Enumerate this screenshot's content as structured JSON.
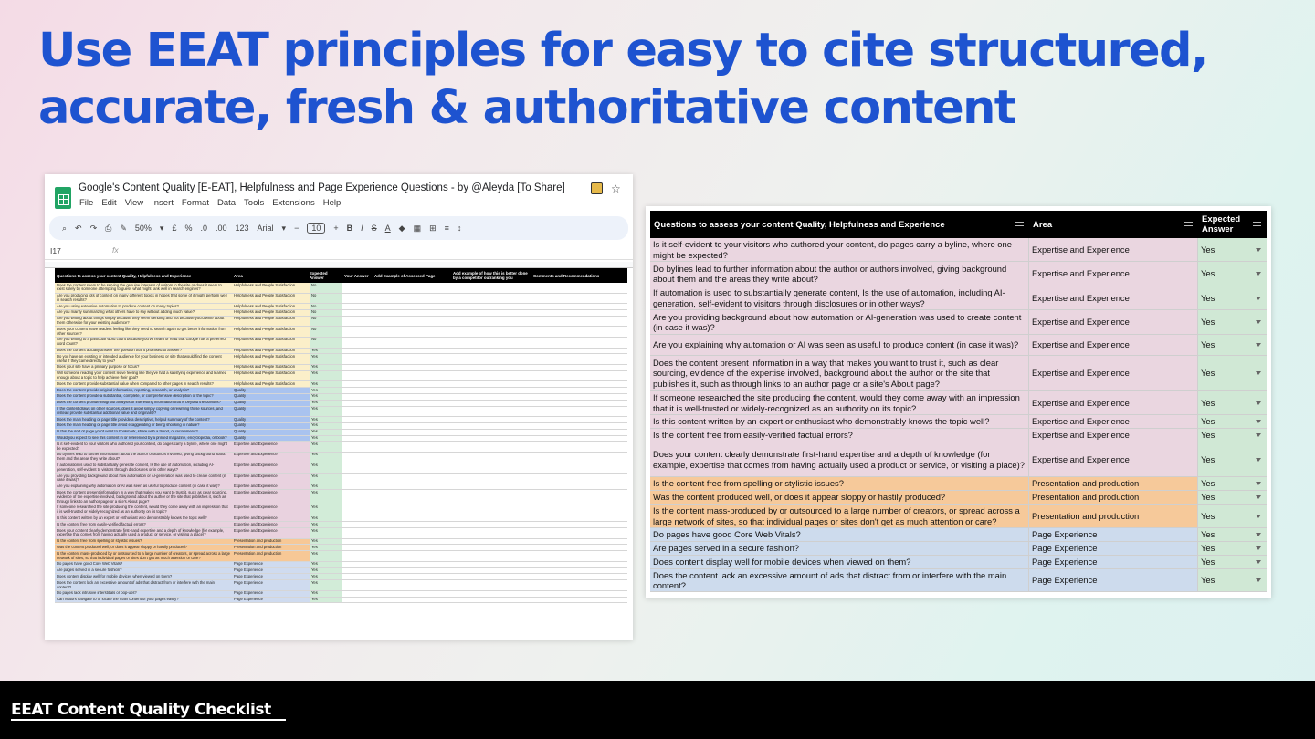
{
  "slide": {
    "title_line1": "Use EEAT principles for easy to cite structured,",
    "title_line2": "accurate, fresh & authoritative content",
    "footer_label": "EEAT Content Quality Checklist"
  },
  "sheet": {
    "title": "Google's Content Quality [E-EAT], Helpfulness and Page Experience Questions - by @Aleyda [To Share]",
    "menu": [
      "File",
      "Edit",
      "View",
      "Insert",
      "Format",
      "Data",
      "Tools",
      "Extensions",
      "Help"
    ],
    "zoom": "50%",
    "font": "Arial",
    "font_size": "10",
    "cell_ref": "I17",
    "fx": "fx",
    "headers": [
      "Questions to assess your content Quality, Helpfulness and Experience",
      "Area",
      "Expected Answer",
      "Your Answer",
      "Add Example of Assessed Page",
      "Add example of how this is better done by a competitor outranking you",
      "Comments and Recommendations"
    ],
    "rows": [
      {
        "q": "Does the content seem to be serving the genuine interests of visitors to the site or does it seem to exist solely by someone attempting to guess what might rank well in search engines?",
        "a": "Helpfulness and People Satisfaction",
        "e": "No",
        "bg": "bg-y"
      },
      {
        "q": "Are you producing lots of content on many different topics in hopes that some of it might perform well in search results?",
        "a": "Helpfulness and People Satisfaction",
        "e": "No",
        "bg": "bg-y"
      },
      {
        "q": "Are you using extensive automation to produce content on many topics?",
        "a": "Helpfulness and People Satisfaction",
        "e": "No",
        "bg": "bg-y"
      },
      {
        "q": "Are you mainly summarizing what others have to say without adding much value?",
        "a": "Helpfulness and People Satisfaction",
        "e": "No",
        "bg": "bg-y"
      },
      {
        "q": "Are you writing about things simply because they seem trending and not because you'd write about them otherwise for your existing audience?",
        "a": "Helpfulness and People Satisfaction",
        "e": "No",
        "bg": "bg-y"
      },
      {
        "q": "Does your content leave readers feeling like they need to search again to get better information from other sources?",
        "a": "Helpfulness and People Satisfaction",
        "e": "No",
        "bg": "bg-y"
      },
      {
        "q": "Are you writing to a particular word count because you've heard or read that Google has a preferred word count?",
        "a": "Helpfulness and People Satisfaction",
        "e": "No",
        "bg": "bg-y"
      },
      {
        "q": "Does the content actually answer the question that it promised to answer?",
        "a": "Helpfulness and People Satisfaction",
        "e": "Yes",
        "bg": "bg-y"
      },
      {
        "q": "Do you have an existing or intended audience for your business or site that would find the content useful if they came directly to you?",
        "a": "Helpfulness and People Satisfaction",
        "e": "Yes",
        "bg": "bg-y"
      },
      {
        "q": "Does your site have a primary purpose or focus?",
        "a": "Helpfulness and People Satisfaction",
        "e": "Yes",
        "bg": "bg-y"
      },
      {
        "q": "Will someone reading your content leave feeling like they've had a satisfying experience and learned enough about a topic to help achieve their goal?",
        "a": "Helpfulness and People Satisfaction",
        "e": "Yes",
        "bg": "bg-y"
      },
      {
        "q": "Does the content provide substantial value when compared to other pages in search results?",
        "a": "Helpfulness and People Satisfaction",
        "e": "Yes",
        "bg": "bg-y"
      },
      {
        "q": "Does the content provide original information, reporting, research, or analysis?",
        "a": "Quality",
        "e": "Yes",
        "bg": "bg-b"
      },
      {
        "q": "Does the content provide a substantial, complete, or comprehensive description of the topic?",
        "a": "Quality",
        "e": "Yes",
        "bg": "bg-b"
      },
      {
        "q": "Does the content provide insightful analysis or interesting information that is beyond the obvious?",
        "a": "Quality",
        "e": "Yes",
        "bg": "bg-b"
      },
      {
        "q": "If the content draws on other sources, does it avoid simply copying or rewriting those sources, and instead provide substantial additional value and originality?",
        "a": "Quality",
        "e": "Yes",
        "bg": "bg-b"
      },
      {
        "q": "Does the main heading or page title provide a descriptive, helpful summary of the content?",
        "a": "Quality",
        "e": "Yes",
        "bg": "bg-b"
      },
      {
        "q": "Does the main heading or page title avoid exaggerating or being shocking in nature?",
        "a": "Quality",
        "e": "Yes",
        "bg": "bg-b"
      },
      {
        "q": "Is this the sort of page you'd want to bookmark, share with a friend, or recommend?",
        "a": "Quality",
        "e": "Yes",
        "bg": "bg-b"
      },
      {
        "q": "Would you expect to see this content in or referenced by a printed magazine, encyclopedia, or book?",
        "a": "Quality",
        "e": "Yes",
        "bg": "bg-b"
      },
      {
        "q": "Is it self-evident to your visitors who authored your content, do pages carry a byline, where one might be expected?",
        "a": "Expertise and Experience",
        "e": "Yes",
        "bg": "bg-p"
      },
      {
        "q": "Do bylines lead to further information about the author or authors involved, giving background about them and the areas they write about?",
        "a": "Expertise and Experience",
        "e": "Yes",
        "bg": "bg-p"
      },
      {
        "q": "If automation is used to substantially generate content, Is the use of automation, including AI-generation, self-evident to visitors through disclosures or in other ways?",
        "a": "Expertise and Experience",
        "e": "Yes",
        "bg": "bg-p"
      },
      {
        "q": "Are you providing background about how automation or AI-generation was used to create content (in case it was)?",
        "a": "Expertise and Experience",
        "e": "Yes",
        "bg": "bg-p"
      },
      {
        "q": "Are you explaining why automation or AI was seen as useful to produce content (in case it was)?",
        "a": "Expertise and Experience",
        "e": "Yes",
        "bg": "bg-p"
      },
      {
        "q": "Does the content present information in a way that makes you want to trust it, such as clear sourcing, evidence of the expertise involved, background about the author or the site that publishes it, such as through links to an author page or a site's About page?",
        "a": "Expertise and Experience",
        "e": "Yes",
        "bg": "bg-p"
      },
      {
        "q": "If someone researched the site producing the content, would they come away with an impression that it is well-trusted or widely-recognized as an authority on its topic?",
        "a": "Expertise and Experience",
        "e": "Yes",
        "bg": "bg-p"
      },
      {
        "q": "Is this content written by an expert or enthusiast who demonstrably knows the topic well?",
        "a": "Expertise and Experience",
        "e": "Yes",
        "bg": "bg-p"
      },
      {
        "q": "Is the content free from easily-verified factual errors?",
        "a": "Expertise and Experience",
        "e": "Yes",
        "bg": "bg-p"
      },
      {
        "q": "Does your content clearly demonstrate first-hand expertise and a depth of knowledge (for example, expertise that comes from having actually used a product or service, or visiting a place)?",
        "a": "Expertise and Experience",
        "e": "Yes",
        "bg": "bg-p"
      },
      {
        "q": "Is the content free from spelling or stylistic issues?",
        "a": "Presentation and production",
        "e": "Yes",
        "bg": "bg-o"
      },
      {
        "q": "Was the content produced well, or does it appear sloppy or hastily produced?",
        "a": "Presentation and production",
        "e": "Yes",
        "bg": "bg-o"
      },
      {
        "q": "Is the content mass-produced by or outsourced to a large number of creators, or spread across a large network of sites, so that individual pages or sites don't get as much attention or care?",
        "a": "Presentation and production",
        "e": "Yes",
        "bg": "bg-o"
      },
      {
        "q": "Do pages have good Core Web Vitals?",
        "a": "Page Experience",
        "e": "Yes",
        "bg": "bg-l"
      },
      {
        "q": "Are pages served in a secure fashion?",
        "a": "Page Experience",
        "e": "Yes",
        "bg": "bg-l"
      },
      {
        "q": "Does content display well for mobile devices when viewed on them?",
        "a": "Page Experience",
        "e": "Yes",
        "bg": "bg-l"
      },
      {
        "q": "Does the content lack an excessive amount of ads that distract from or interfere with the main content?",
        "a": "Page Experience",
        "e": "Yes",
        "bg": "bg-l"
      },
      {
        "q": "Do pages lack intrusive interstitials or pop-ups?",
        "a": "Page Experience",
        "e": "Yes",
        "bg": "bg-l"
      },
      {
        "q": "Can visitors navigate to or locate the main content of your pages easily?",
        "a": "Page Experience",
        "e": "Yes",
        "bg": "bg-l"
      }
    ]
  },
  "table": {
    "headers": [
      "Questions to assess your content Quality, Helpfulness and Experience",
      "Area",
      "Expected Answer"
    ],
    "rows": [
      {
        "q": "Is it self-evident to your visitors who authored your content, do pages carry a byline, where one might be expected?",
        "a": "Expertise and Experience",
        "e": "Yes",
        "cls": "a-pink",
        "h": 26
      },
      {
        "q": "Do bylines lead to further information about the author or authors involved, giving background about them and the areas they write about?",
        "a": "Expertise and Experience",
        "e": "Yes",
        "cls": "a-pink",
        "h": 27
      },
      {
        "q": "If automation is used to substantially generate content, Is the use of automation, including AI-generation, self-evident to visitors through disclosures or in other ways?",
        "a": "Expertise and Experience",
        "e": "Yes",
        "cls": "a-pink",
        "h": 26
      },
      {
        "q": "Are you providing background about how automation or AI-generation was used to create content (in case it was)?",
        "a": "Expertise and Experience",
        "e": "Yes",
        "cls": "a-pink",
        "h": 27
      },
      {
        "q": "Are you explaining why automation or AI was seen as useful to produce content (in case it was)?",
        "a": "Expertise and Experience",
        "e": "Yes",
        "cls": "a-pink",
        "h": 23
      },
      {
        "q": "Does the content present information in a way that makes you want to trust it, such as clear sourcing, evidence of the expertise involved, background about the author or the site that publishes it, such as through links to an author page or a site's About page?",
        "a": "Expertise and Experience",
        "e": "Yes",
        "cls": "a-pink",
        "h": 39
      },
      {
        "q": "If someone researched the site producing the content, would they come away with an impression that it is well-trusted or widely-recognized as an authority on its topic?",
        "a": "Expertise and Experience",
        "e": "Yes",
        "cls": "a-pink",
        "h": 26
      },
      {
        "q": "Is this content written by an expert or enthusiast who demonstrably knows the topic well?",
        "a": "Expertise and Experience",
        "e": "Yes",
        "cls": "a-pink",
        "h": 15
      },
      {
        "q": "Is the content free from easily-verified factual errors?",
        "a": "Expertise and Experience",
        "e": "Yes",
        "cls": "a-pink",
        "h": 15
      },
      {
        "q": "Does your content clearly demonstrate first-hand expertise and a depth of knowledge (for example, expertise that comes from having actually used a product or service, or visiting a place)?",
        "a": "Expertise and Experience",
        "e": "Yes",
        "cls": "a-pink",
        "h": 38
      },
      {
        "q": "Is the content free from spelling or stylistic issues?",
        "a": "Presentation and production",
        "e": "Yes",
        "cls": "a-orange",
        "h": 15
      },
      {
        "q": "Was the content produced well, or does it appear sloppy or hastily produced?",
        "a": "Presentation and production",
        "e": "Yes",
        "cls": "a-orange",
        "h": 15
      },
      {
        "q": "Is the content mass-produced by or outsourced to a large number of creators, or spread across a large network of sites, so that individual pages or sites don't get as much attention or care?",
        "a": "Presentation and production",
        "e": "Yes",
        "cls": "a-orange",
        "h": 26
      },
      {
        "q": "Do pages have good Core Web Vitals?",
        "a": "Page Experience",
        "e": "Yes",
        "cls": "a-blue",
        "h": 15
      },
      {
        "q": "Are pages served in a secure fashion?",
        "a": "Page Experience",
        "e": "Yes",
        "cls": "a-blue",
        "h": 15
      },
      {
        "q": "Does content display well for mobile devices when viewed on them?",
        "a": "Page Experience",
        "e": "Yes",
        "cls": "a-blue",
        "h": 15
      },
      {
        "q": "Does the content lack an excessive amount of ads that distract from or interfere with the main content?",
        "a": "Page Experience",
        "e": "Yes",
        "cls": "a-blue",
        "h": 25
      }
    ]
  }
}
